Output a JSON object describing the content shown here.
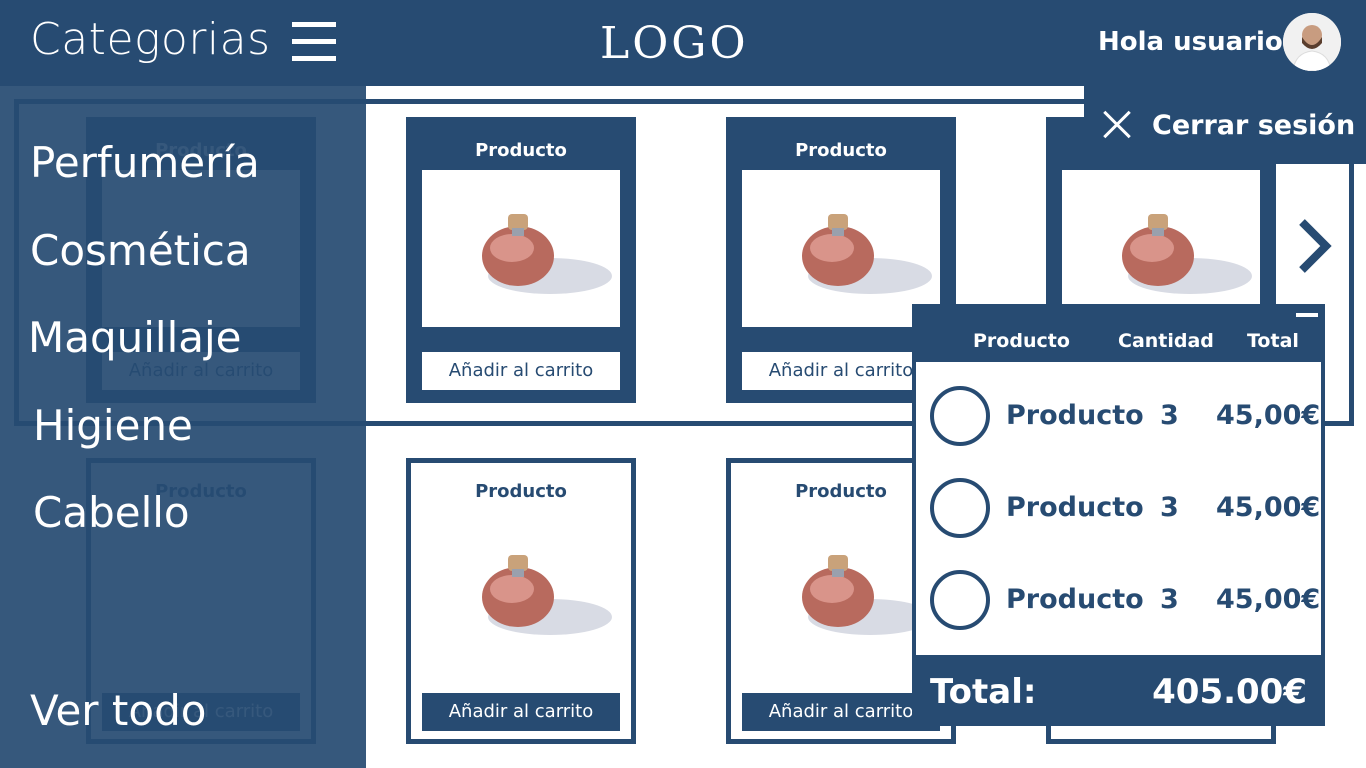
{
  "header": {
    "categories_title": "Categorias",
    "logo": "LOGO",
    "greeting": "Hola usuario"
  },
  "user_menu": {
    "logout_label": "Cerrar sesión"
  },
  "sidebar": {
    "items": [
      "Perfumería",
      "Cosmética",
      "Maquillaje",
      "Higiene",
      "Cabello"
    ],
    "view_all": "Ver todo"
  },
  "products": {
    "title": "Producto",
    "add_to_cart": "Añadir al carrito"
  },
  "cart": {
    "headers": {
      "product": "Producto",
      "quantity": "Cantidad",
      "total": "Total"
    },
    "items": [
      {
        "name": "Producto",
        "qty": "3",
        "price": "45,00€"
      },
      {
        "name": "Producto",
        "qty": "3",
        "price": "45,00€"
      },
      {
        "name": "Producto",
        "qty": "3",
        "price": "45,00€"
      }
    ],
    "total_label": "Total:",
    "total_value": "405.00€"
  },
  "colors": {
    "primary": "#274b72",
    "background": "#ffffff"
  }
}
